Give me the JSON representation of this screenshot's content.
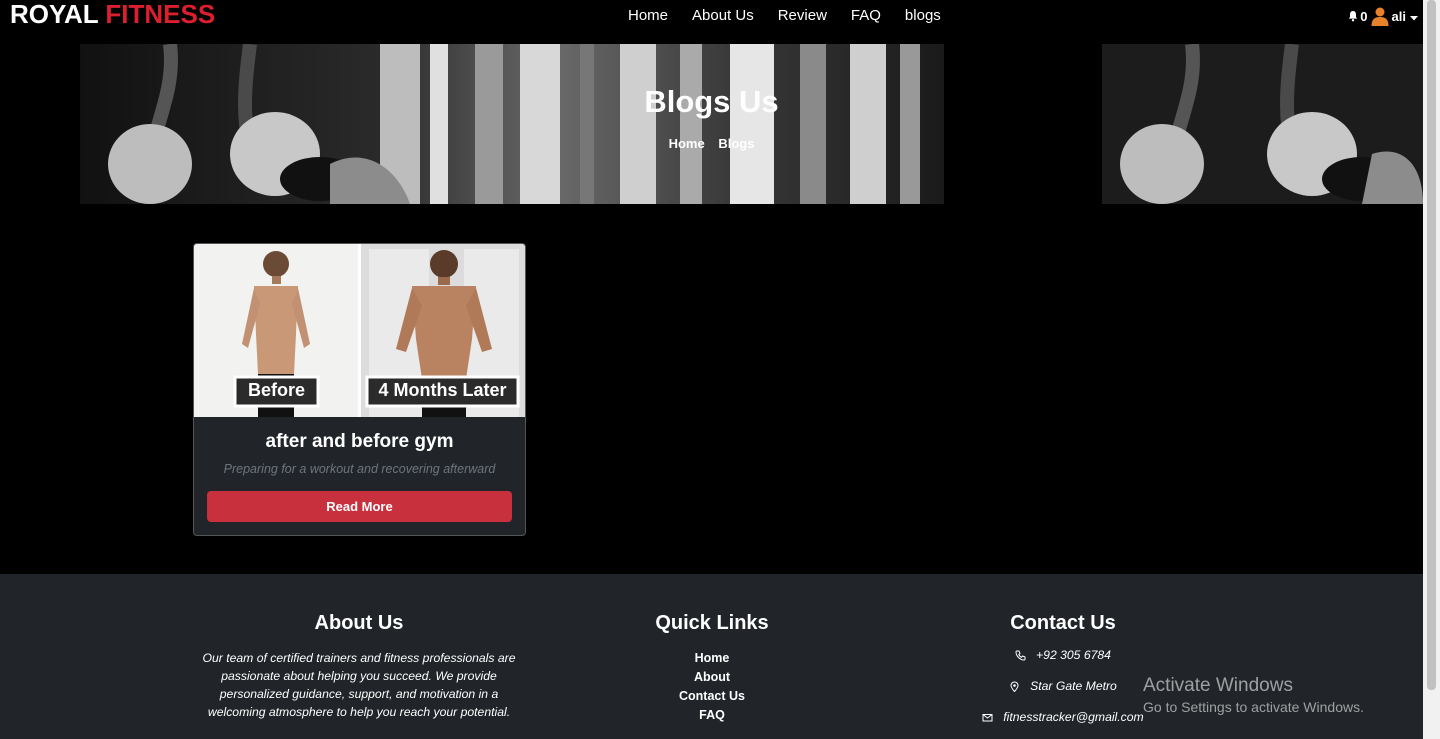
{
  "brand": {
    "word1": "ROYAL",
    "word2": "FITNESS"
  },
  "nav": {
    "items": [
      {
        "label": "Home"
      },
      {
        "label": "About Us"
      },
      {
        "label": "Review"
      },
      {
        "label": "FAQ"
      },
      {
        "label": "blogs"
      }
    ],
    "notification_count": "0",
    "username": "ali"
  },
  "hero": {
    "title": "Blogs Us",
    "breadcrumb": [
      "Home",
      "Blogs"
    ]
  },
  "blog_card": {
    "image_labels": [
      "Before",
      "4 Months Later"
    ],
    "title": "after and before gym",
    "description": "Preparing for a workout and recovering afterward",
    "button_label": "Read More"
  },
  "footer": {
    "about": {
      "heading": "About Us",
      "text": "Our team of certified trainers and fitness professionals are passionate about helping you succeed. We provide personalized guidance, support, and motivation in a welcoming atmosphere to help you reach your potential."
    },
    "quick_links": {
      "heading": "Quick Links",
      "items": [
        "Home",
        "About",
        "Contact Us",
        "FAQ"
      ]
    },
    "contact": {
      "heading": "Contact Us",
      "phone": "+92 305 6784",
      "address": "Star Gate Metro",
      "email": "fitnesstracker@gmail.com"
    }
  },
  "watermark": {
    "line1": "Activate Windows",
    "line2": "Go to Settings to activate Windows."
  },
  "colors": {
    "brand_red": "#dc1f2e",
    "button_red": "#c9303e",
    "footer_bg": "#212529",
    "page_bg": "#000000"
  }
}
